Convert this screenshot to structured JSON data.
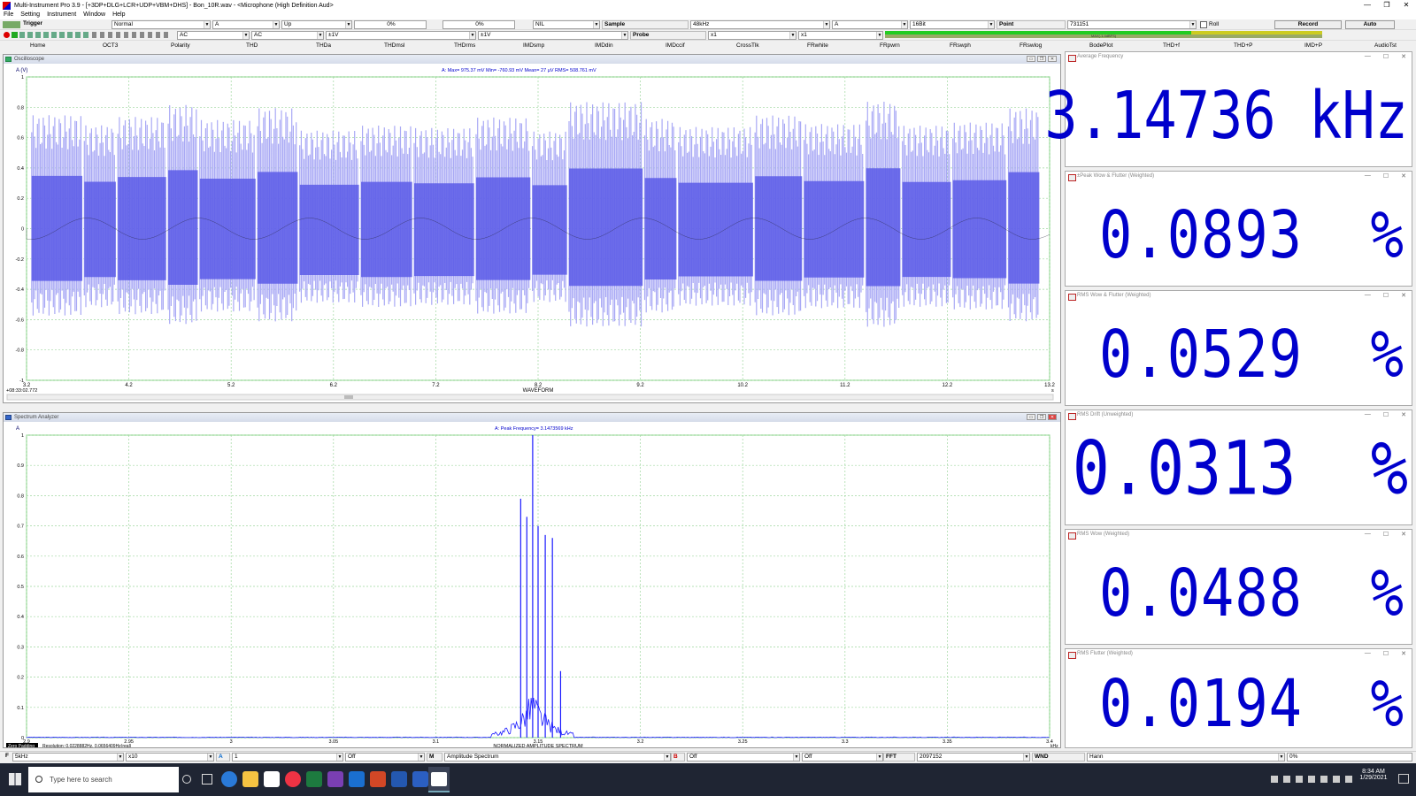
{
  "window": {
    "title": "Multi-Instrument Pro 3.9  -  [+3DP+DLG+LCR+UDP+VBM+DHS]  -  Bon_10R.wav  -  <Microphone (High Definition Aud>",
    "min": "—",
    "max": "❐",
    "close": "✕"
  },
  "menu": [
    "File",
    "Setting",
    "Instrument",
    "Window",
    "Help"
  ],
  "toolbar1": {
    "trigger_label": "Trigger",
    "mode": "Normal",
    "channel": "A",
    "edge": "Up",
    "level": "0%",
    "pretrigger": "0%",
    "nil": "NIL",
    "sample_label": "Sample",
    "sample_rate": "48kHz",
    "sample_ch": "A",
    "bits": "16Bit",
    "point_label": "Point",
    "points": "731151",
    "roll_label": "Roll",
    "record_label": "Record",
    "auto_label": "Auto"
  },
  "toolbar2": {
    "coupling_a": "AC",
    "coupling_b": "AC",
    "range_a": "±1V",
    "range_b": "±1V",
    "probe_label": "Probe",
    "probe_a": "x1",
    "probe_b": "x1",
    "level_meter": "MAX(-1.4dBFS)"
  },
  "tabs": [
    "Home",
    "OCT3",
    "Polarity",
    "THD",
    "THDa",
    "THDmsl",
    "THDrms",
    "IMDsmp",
    "IMDdin",
    "IMDccif",
    "CrossTlk",
    "FRwhite",
    "FRpwrn",
    "FRswph",
    "FRswlog",
    "BodePlot",
    "THD+f",
    "THD+P",
    "IMD+P",
    "AudioTst"
  ],
  "oscilloscope": {
    "title": "Oscilloscope",
    "channel_label": "A (V)",
    "readout": "A: Max=   975.37  mV  Min=   -760.93  mV  Mean=        27  µV  RMS=   508.761  mV",
    "caption": "WAVEFORM",
    "time_start": "+08:33:02.772",
    "x_unit": "s",
    "chart_data": {
      "type": "line",
      "xlabel": "WAVEFORM",
      "ylabel": "A (V)",
      "xlim": [
        3.2,
        13.2
      ],
      "ylim": [
        -1,
        1
      ],
      "x_ticks": [
        "3.2",
        "4.2",
        "5.2",
        "6.2",
        "7.2",
        "8.2",
        "9.2",
        "10.2",
        "11.2",
        "12.2",
        "13.2"
      ],
      "y_ticks": [
        "1",
        "0.8",
        "0.6",
        "0.4",
        "0.2",
        "0",
        "-0.2",
        "-0.4",
        "-0.6",
        "-0.8",
        "-1"
      ],
      "grid": true,
      "max_mV": 975.37,
      "min_mV": -760.93,
      "mean_uV": 27,
      "rms_mV": 508.761
    }
  },
  "spectrum": {
    "title": "Spectrum Analyzer",
    "channel_label": "A",
    "readout": "A: Peak Frequency=    3.1473569  kHz",
    "caption": "NORMALIZED AMPLITUDE SPECTRUM",
    "zero_padding": "Zero Padding",
    "resolution": "Resolution: 0.0228882Hz, 0.0656409Hz(real)",
    "x_unit": "kHz",
    "chart_data": {
      "type": "line",
      "xlabel": "NORMALIZED AMPLITUDE SPECTRUM",
      "xlim": [
        2.9,
        3.4
      ],
      "ylim": [
        0,
        1
      ],
      "x_ticks": [
        "2.9",
        "2.95",
        "3",
        "3.05",
        "3.1",
        "3.15",
        "3.2",
        "3.25",
        "3.3",
        "3.35",
        "3.4"
      ],
      "y_ticks": [
        "1",
        "0.9",
        "0.8",
        "0.7",
        "0.6",
        "0.5",
        "0.4",
        "0.3",
        "0.2",
        "0.1",
        "0"
      ],
      "grid": true,
      "peak_kHz": 3.1473569,
      "peaks": [
        {
          "x": 3.1415,
          "y": 0.79
        },
        {
          "x": 3.1445,
          "y": 0.73
        },
        {
          "x": 3.1473569,
          "y": 1.0
        },
        {
          "x": 3.15,
          "y": 0.7
        },
        {
          "x": 3.1535,
          "y": 0.67
        },
        {
          "x": 3.157,
          "y": 0.66
        },
        {
          "x": 3.161,
          "y": 0.22
        }
      ]
    }
  },
  "meters": [
    {
      "title": "Average Frequency",
      "value": "3.14736 kHz"
    },
    {
      "title": "±Peak Wow & Flutter (Weighted)",
      "value": "0.0893  %"
    },
    {
      "title": "RMS Wow & Flutter (Weighted)",
      "value": "0.0529  %"
    },
    {
      "title": "RMS Drift (Unweighted)",
      "value": "0.0313  %"
    },
    {
      "title": "RMS Wow (Weighted)",
      "value": "0.0488  %"
    },
    {
      "title": "RMS Flutter (Weighted)",
      "value": "0.0194  %"
    }
  ],
  "bottom": {
    "f_label": "F",
    "freq_range": "5kHz",
    "zoom": "x10",
    "a_label": "A",
    "a_val": "1",
    "a_off": "Off",
    "m_label": "M",
    "mode": "Amplitude Spectrum",
    "b_label": "B",
    "b_off": "Off",
    "b_off2": "Off",
    "fft_label": "FFT",
    "fft_size": "2097152",
    "wnd_label": "WND",
    "window": "Hann",
    "overlap": "0%"
  },
  "taskbar": {
    "search_placeholder": "Type here to search",
    "time": "8:34 AM",
    "date": "1/29/2021"
  },
  "colors": {
    "signal_light": "#a9a9f5",
    "signal_dark": "#5a5ae8",
    "spectrum": "#1a1aff",
    "grid": "#9fd79f",
    "meter_text": "#0000cc"
  }
}
